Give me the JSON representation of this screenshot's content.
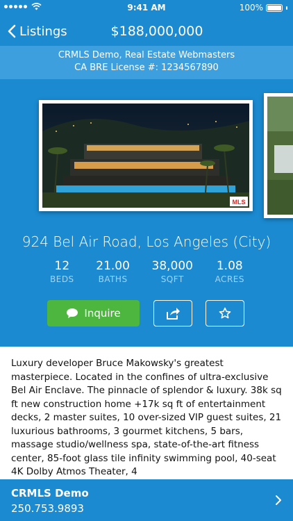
{
  "status_bar": {
    "time": "9:41 AM",
    "battery_percent": "100%",
    "icons": [
      "signal-dots-icon",
      "wifi-icon",
      "battery-icon"
    ]
  },
  "nav": {
    "back_label": "Listings",
    "title": "$188,000,000"
  },
  "agent_banner": {
    "line1": "CRMLS Demo, Real Estate Webmasters",
    "line2": "CA BRE License #: 1234567890"
  },
  "listing": {
    "address": "924 Bel Air Road, Los Angeles (City)",
    "photo_watermark": "MLS",
    "stats": [
      {
        "value": "12",
        "label": "BEDS"
      },
      {
        "value": "21.00",
        "label": "BATHS"
      },
      {
        "value": "38,000",
        "label": "SQFT"
      },
      {
        "value": "1.08",
        "label": "ACRES"
      }
    ]
  },
  "actions": {
    "inquire_label": "Inquire",
    "share_icon": "share-icon",
    "favorite_icon": "star-icon"
  },
  "description": "Luxury developer Bruce Makowsky's greatest masterpiece. Located in the confines of ultra-exclusive Bel Air Enclave. The pinnacle of splendor & luxury. 38k sq ft new construction home +17k sq ft of entertainment decks, 2 master suites, 10 over-sized VIP guest suites, 21 luxurious bathrooms, 3 gourmet kitchens, 5 bars, massage studio/wellness spa, state-of-the-art fitness center, 85-foot glass tile infinity swimming pool, 40-seat 4K Dolby Atmos Theater, 4",
  "footer": {
    "agent_name": "CRMLS Demo",
    "phone": "250.753.9893"
  },
  "colors": {
    "primary_blue": "#1b8ad1",
    "banner_blue": "#3d9fdd",
    "inquire_green": "#4cb63f",
    "label_light_blue": "#a8d4f2"
  }
}
